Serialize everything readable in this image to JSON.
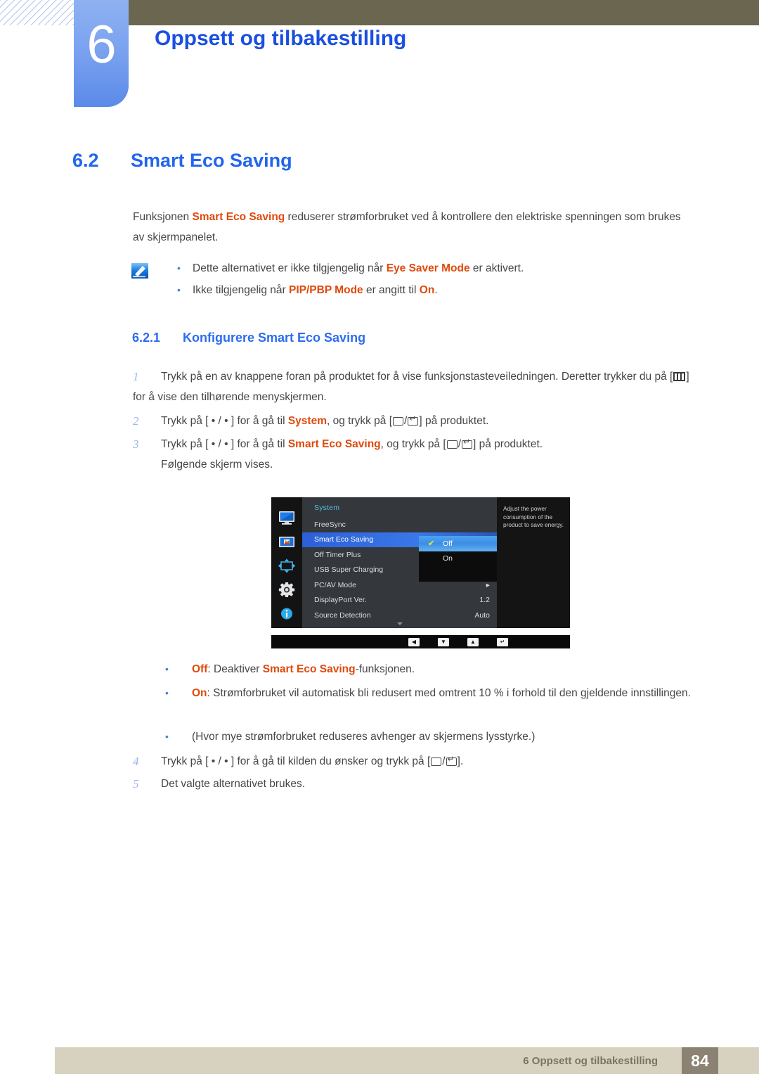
{
  "header": {
    "chapter_number": "6",
    "chapter_title": "Oppsett og tilbakestilling",
    "accent_blue": "#2266ee",
    "band_olive": "#6b664f"
  },
  "section": {
    "number": "6.2",
    "title": "Smart Eco Saving"
  },
  "intro": {
    "line1_a": "Funksjonen ",
    "line1_hl": "Smart Eco Saving",
    "line1_b": " reduserer strømforbruket ved å kontrollere den elektriske spenningen som brukes av skjermpanelet."
  },
  "note": {
    "icon": "note-pen-icon",
    "bullets": [
      {
        "a": "Dette alternativet er ikke tilgjengelig når ",
        "hl": "Eye Saver Mode",
        "b": " er aktivert."
      },
      {
        "a": "Ikke tilgjengelig når ",
        "hl": "PIP/PBP Mode",
        "b": " er angitt til ",
        "hl2": "On",
        "c": "."
      }
    ]
  },
  "subsection": {
    "number": "6.2.1",
    "title": "Konfigurere Smart Eco Saving"
  },
  "steps": [
    {
      "n": "1",
      "a": "Trykk på en av knappene foran på produktet for å vise funksjonstasteveiledningen. Deretter trykker du på [",
      "key": "menu-key-icon",
      "b": "] for å vise den tilhørende menyskjermen."
    },
    {
      "n": "2",
      "a": "Trykk på [ • / • ] for å gå til ",
      "hl": "System",
      "b": ", og trykk på [",
      "keys": "back-enter-key-icon",
      "c": "] på produktet."
    },
    {
      "n": "3",
      "a": "Trykk på [ • / • ] for å gå til ",
      "hl": "Smart Eco Saving",
      "b": ", og trykk på [",
      "keys": "back-enter-key-icon",
      "c": "] på produktet.",
      "extra": "Følgende skjerm vises."
    },
    {
      "n": "4",
      "a": "Trykk på [ • / • ] for å gå til kilden du ønsker og trykk på [",
      "keys": "back-enter-key-icon",
      "c": "]."
    },
    {
      "n": "5",
      "a": "Det valgte alternativet brukes."
    }
  ],
  "osd": {
    "menu_title": "System",
    "sidebar_icons": [
      "monitor-display-icon",
      "picture-color-icon",
      "pip-arrows-icon",
      "gear-system-icon",
      "info-icon"
    ],
    "items": [
      {
        "label": "FreeSync",
        "value": "",
        "selected": false
      },
      {
        "label": "Smart Eco Saving",
        "value": "",
        "selected": true
      },
      {
        "label": "Off Timer Plus",
        "value": "",
        "selected": false
      },
      {
        "label": "USB Super Charging",
        "value": "",
        "selected": false
      },
      {
        "label": "PC/AV Mode",
        "value": "▸",
        "selected": false
      },
      {
        "label": "DisplayPort Ver.",
        "value": "1.2",
        "selected": false
      },
      {
        "label": "Source Detection",
        "value": "Auto",
        "selected": false
      }
    ],
    "submenu": [
      {
        "label": "Off",
        "selected": true,
        "check": "✔"
      },
      {
        "label": "On",
        "selected": false,
        "check": ""
      }
    ],
    "help_text": "Adjust the power consumption of the product to save energy.",
    "buttons": [
      "◀",
      "▼",
      "▲",
      "↵"
    ],
    "highlight_blue": "#3a78e8",
    "check_color": "#cfe53c"
  },
  "options": [
    {
      "hl": "Off",
      "a": ": Deaktiver ",
      "hl2": "Smart Eco Saving",
      "b": "-funksjonen."
    },
    {
      "hl": "On",
      "a": ": Strømforbruket vil automatisk bli redusert med omtrent 10 % i forhold til den gjeldende innstillingen.",
      "extra": "(Hvor mye strømforbruket reduseres avhenger av skjermens lysstyrke.)"
    }
  ],
  "footer": {
    "text": "6 Oppsett og tilbakestilling",
    "page": "84",
    "band_color": "#d7d2bf",
    "page_box_color": "#8c8274"
  }
}
